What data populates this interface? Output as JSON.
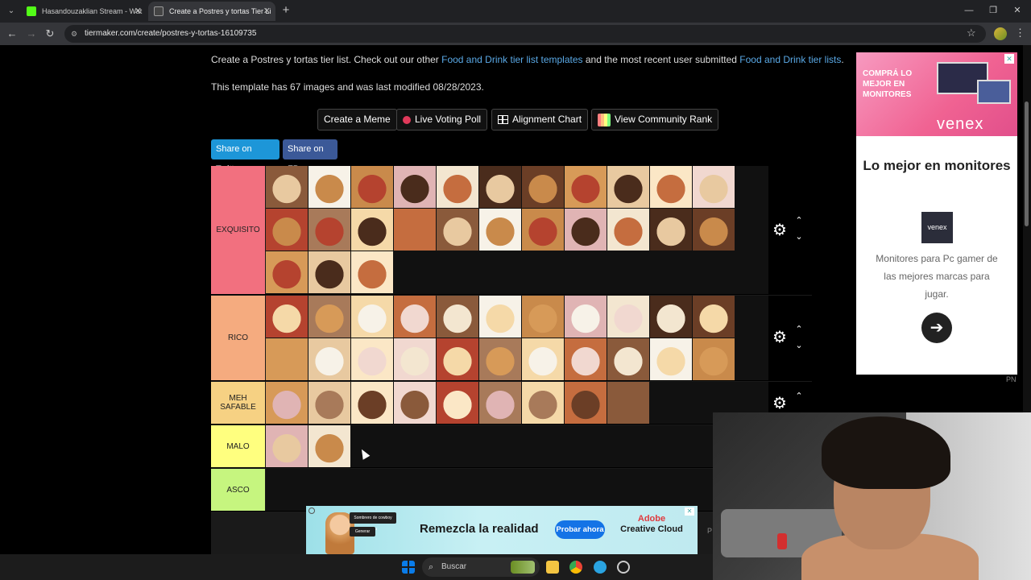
{
  "browser": {
    "tabs": [
      {
        "title": "Hasandouzaklian Stream - Wat",
        "favicon_color": "#53fc18"
      },
      {
        "title": "Create a Postres y tortas Tier Li",
        "favicon_color": "#222"
      }
    ],
    "url": "tiermaker.com/create/postres-y-tortas-16109735"
  },
  "intro": {
    "prefix": "Create a Postres y tortas tier list. Check out our other ",
    "link1": "Food and Drink tier list templates",
    "middle": " and the most recent user submitted ",
    "link2": "Food and Drink tier lists",
    "suffix": "."
  },
  "template_info": "This template has 67 images and was last modified 08/28/2023.",
  "toolbar": {
    "meme": "Create a Meme",
    "poll": "Live Voting Poll",
    "alignment": "Alignment Chart",
    "rank": "View Community Rank"
  },
  "share": {
    "twitter": "Share on Twitter",
    "facebook": "Share on FB"
  },
  "tiers": [
    {
      "label": "EXQUISITO",
      "color": "#f2707f",
      "count": 25
    },
    {
      "label": "RICO",
      "color": "#f5ab7f",
      "count": 22
    },
    {
      "label": "MEH SAFABLE",
      "color": "#f6d183",
      "count": 9
    },
    {
      "label": "MALO",
      "color": "#ffff7f",
      "count": 2
    },
    {
      "label": "ASCO",
      "color": "#c6f57f",
      "count": 0
    }
  ],
  "ad": {
    "banner_text": "COMPRÁ LO MEJOR EN MONITORES",
    "brand": "venex",
    "title": "Lo mejor en monitores",
    "logo": "venex",
    "description": "Monitores para Pc gamer de las mejores marcas para jugar.",
    "cta_icon": "arrow-right-icon",
    "tag": "PN"
  },
  "bottom_ad": {
    "bubble1": "Sombrero de cowboy rosa",
    "bubble2": "Generar",
    "headline": "Remezcla la realidad",
    "cta": "Probar ahora",
    "brand_line1": "Adobe",
    "brand_line2": "Creative Cloud",
    "tag": "P"
  },
  "taskbar": {
    "search_placeholder": "Buscar"
  }
}
